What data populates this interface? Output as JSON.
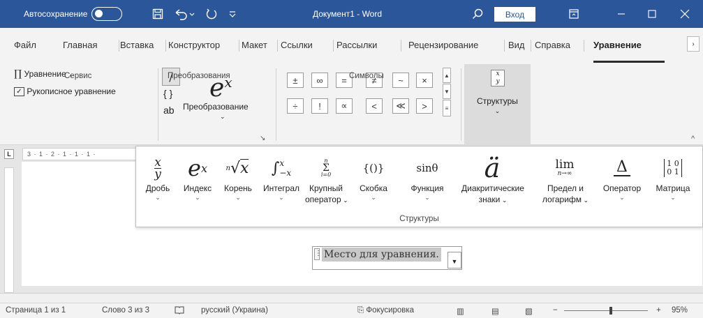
{
  "window": {
    "autosave_label": "Автосохранение",
    "title": "Документ1 - Word",
    "sign_in": "Вход",
    "icons": [
      "save-icon",
      "undo-icon",
      "redo-icon",
      "customize-icon",
      "search-icon",
      "ribbon-display-icon",
      "minimize-icon",
      "maximize-icon",
      "close-icon"
    ]
  },
  "tabs": {
    "items": [
      "Файл",
      "Главная",
      "Вставка",
      "Конструктор",
      "Макет",
      "Ссылки",
      "Рассылки",
      "Рецензирование",
      "Вид",
      "Справка",
      "Уравнение"
    ],
    "active": "Уравнение"
  },
  "ribbon": {
    "service": {
      "equation": "Уравнение",
      "ink_equation": "Рукописное уравнение",
      "label": "Сервис"
    },
    "conversions": {
      "convert": "Преобразование",
      "label": "Преобразования"
    },
    "symbols": {
      "row1": [
        "±",
        "∞",
        "=",
        "≠",
        "~",
        "×"
      ],
      "row2": [
        "÷",
        "!",
        "∝",
        "<",
        "≪",
        ">"
      ],
      "label": "Символы"
    },
    "structures_button": "Структуры"
  },
  "structures_panel": {
    "items": [
      {
        "label": "Дробь",
        "sublabel": ""
      },
      {
        "label": "Индекс",
        "sublabel": ""
      },
      {
        "label": "Корень",
        "sublabel": ""
      },
      {
        "label": "Интеграл",
        "sublabel": ""
      },
      {
        "label": "Крупный",
        "sublabel": "оператор"
      },
      {
        "label": "Скобка",
        "sublabel": ""
      },
      {
        "label": "Функция",
        "sublabel": ""
      },
      {
        "label": "Диакритические",
        "sublabel": "знаки"
      },
      {
        "label": "Предел и",
        "sublabel": "логарифм"
      },
      {
        "label": "Оператор",
        "sublabel": ""
      },
      {
        "label": "Матрица",
        "sublabel": ""
      }
    ],
    "group_label": "Структуры"
  },
  "document": {
    "equation_placeholder": "Место для уравнения."
  },
  "statusbar": {
    "page": "Страница 1 из 1",
    "words": "Слово 3 из 3",
    "language": "русский (Украина)",
    "focus": "Фокусировка",
    "zoom": "95%"
  },
  "colors": {
    "titlebar": "#2b579a",
    "ribbon": "#f3f3f3",
    "placeholder_highlight": "#c8c8c8"
  }
}
